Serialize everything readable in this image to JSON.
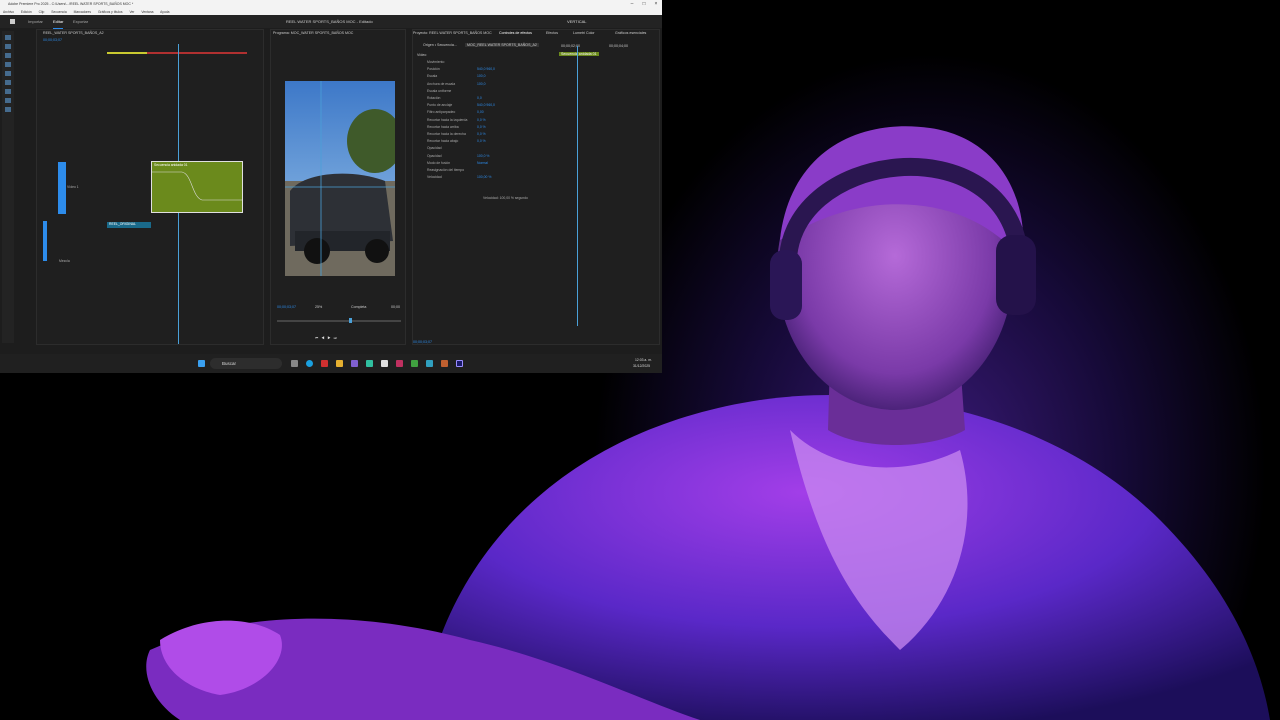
{
  "window": {
    "title": "Adobe Premiere Pro 2025 - C:\\Users\\...\\REEL WATER SPORTS_BAÑOS MOC *",
    "project_title": "REEL WATER SPORTS_BAÑOS MOC - Editado"
  },
  "menu": [
    "Archivo",
    "Edición",
    "Clip",
    "Secuencia",
    "Marcadores",
    "Gráficos y títulos",
    "Ver",
    "Ventana",
    "Ayuda"
  ],
  "modes": [
    "Inicio",
    "Importar",
    "Editar",
    "Exportar"
  ],
  "workspace_label": "VERTICAL",
  "timeline": {
    "tab": "REEL_WATER SPORTS_BAÑOS_A2",
    "timecode": "00;00;03;07",
    "video_track": "Vídeo 1",
    "audio_clip": "REEL_ORIGINAL",
    "mix_label": "Mezcla",
    "nested_clip": "Secuencia anidada 01"
  },
  "program": {
    "tab": "Programa: MOC_WATER SPORTS_BAÑOS MOC",
    "timecode": "00;00;03;07",
    "zoom": "25%",
    "quality": "Completa",
    "duration": "00;00"
  },
  "effects": {
    "tabs": [
      "Proyecto: REEL WATER SPORTS_BAÑOS MOC",
      "Controles de efectos",
      "Efectos",
      "Lumetri Color",
      "Gráficos esenciales"
    ],
    "source": "Origen • Secuencia...",
    "sequence": "MOC_REEL WATER SPORTS_BAÑOS_A2",
    "clip": "Secuencia anidada 01",
    "section_video": "Vídeo",
    "properties": [
      {
        "name": "Movimiento",
        "value": ""
      },
      {
        "name": "Posición",
        "value": "540,0   960,0"
      },
      {
        "name": "Escala",
        "value": "100,0"
      },
      {
        "name": "Anchura de escala",
        "value": "100,0"
      },
      {
        "name": "Escala uniforme",
        "value": ""
      },
      {
        "name": "Rotación",
        "value": "0,0"
      },
      {
        "name": "Punto de anclaje",
        "value": "540,0   960,0"
      },
      {
        "name": "Filtro antiparpadeo",
        "value": "0,00"
      },
      {
        "name": "Recortar hacia la izquierda",
        "value": "0,0 %"
      },
      {
        "name": "Recortar hacia arriba",
        "value": "0,0 %"
      },
      {
        "name": "Recortar hacia la derecha",
        "value": "0,0 %"
      },
      {
        "name": "Recortar hacia abajo",
        "value": "0,0 %"
      },
      {
        "name": "Opacidad",
        "value": ""
      },
      {
        "name": "Opacidad",
        "value": "100,0 %"
      },
      {
        "name": "Modo de fusión",
        "value": "Normal"
      },
      {
        "name": "Reasignación del tiempo",
        "value": ""
      },
      {
        "name": "Velocidad",
        "value": "100,00 %"
      }
    ],
    "speed_note": "Velocidad: 100,00 % segundo",
    "timecode": "00;00;03;07",
    "ruler_a": "00;00;02;00",
    "ruler_b": "00;00;04;00"
  },
  "taskbar": {
    "search": "Buscar",
    "time": "12:03 a. m.",
    "date": "31/12/2025"
  },
  "colors": {
    "accent": "#2d8ceb",
    "clip_green": "#6b8a1c",
    "background_purple": "#3a1a78"
  }
}
